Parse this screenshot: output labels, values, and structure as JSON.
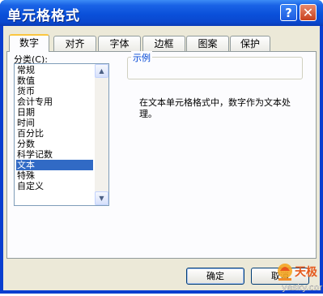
{
  "window": {
    "title": "单元格格式"
  },
  "tabs": [
    {
      "label": "数字"
    },
    {
      "label": "对齐"
    },
    {
      "label": "字体"
    },
    {
      "label": "边框"
    },
    {
      "label": "图案"
    },
    {
      "label": "保护"
    }
  ],
  "category": {
    "label": "分类(C):",
    "items": [
      "常规",
      "数值",
      "货币",
      "会计专用",
      "日期",
      "时间",
      "百分比",
      "分数",
      "科学记数",
      "文本",
      "特殊",
      "自定义"
    ],
    "selected": "文本"
  },
  "sample": {
    "label": "示例"
  },
  "description": "在文本单元格格式中，数字作为文本处理。",
  "buttons": {
    "ok": "确定",
    "cancel": "取消"
  },
  "watermark": {
    "brand": "天极",
    "site": "yesky.com"
  }
}
